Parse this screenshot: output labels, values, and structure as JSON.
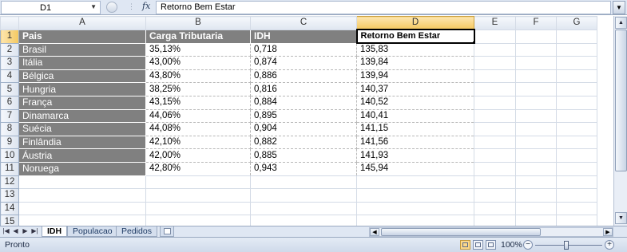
{
  "formula_bar": {
    "name_box": "D1",
    "fx_label": "fx",
    "content": "Retorno Bem Estar"
  },
  "columns": [
    "A",
    "B",
    "C",
    "D",
    "E",
    "F",
    "G"
  ],
  "selected_column": "D",
  "selected_row": 1,
  "header_row": {
    "A": "Pais",
    "B": "Carga Tributaria",
    "C": "IDH",
    "D": "Retorno Bem Estar"
  },
  "rows": [
    {
      "num": "2",
      "A": "Brasil",
      "B": "35,13%",
      "C": "0,718",
      "D": "135,83"
    },
    {
      "num": "3",
      "A": "Itália",
      "B": "43,00%",
      "C": "0,874",
      "D": "139,84"
    },
    {
      "num": "4",
      "A": "Bélgica",
      "B": "43,80%",
      "C": "0,886",
      "D": "139,94"
    },
    {
      "num": "5",
      "A": "Hungria",
      "B": "38,25%",
      "C": "0,816",
      "D": "140,37"
    },
    {
      "num": "6",
      "A": "França",
      "B": "43,15%",
      "C": "0,884",
      "D": "140,52"
    },
    {
      "num": "7",
      "A": "Dinamarca",
      "B": "44,06%",
      "C": "0,895",
      "D": "140,41"
    },
    {
      "num": "8",
      "A": "Suécia",
      "B": "44,08%",
      "C": "0,904",
      "D": "141,15"
    },
    {
      "num": "9",
      "A": "Finlândia",
      "B": "42,10%",
      "C": "0,882",
      "D": "141,56"
    },
    {
      "num": "10",
      "A": "Áustria",
      "B": "42,00%",
      "C": "0,885",
      "D": "141,93"
    },
    {
      "num": "11",
      "A": "Noruega",
      "B": "42,80%",
      "C": "0,943",
      "D": "145,94"
    }
  ],
  "empty_rows": [
    "12",
    "13",
    "14",
    "15"
  ],
  "sheet_tabs": [
    "IDH",
    "Populacao",
    "Pedidos"
  ],
  "active_sheet": "IDH",
  "status": {
    "mode": "Pronto",
    "zoom": "100%",
    "zoom_out": "−",
    "zoom_in": "+"
  },
  "colors": {
    "header_fill": "#808080",
    "selection_highlight": "#f4c860"
  }
}
